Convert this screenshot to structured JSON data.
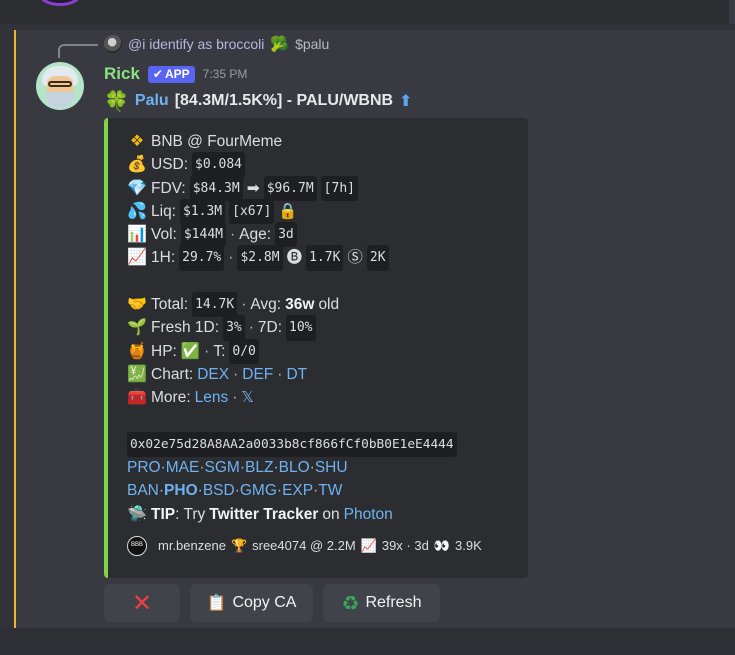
{
  "reply": {
    "mention": "@i identify as broccoli",
    "text": "$palu"
  },
  "message": {
    "username": "Rick",
    "badge": "APP",
    "time": "7:35 PM",
    "title_link": "Palu",
    "title_rest": "[84.3M/1.5K%] - PALU/WBNB"
  },
  "embed": {
    "chain": "BNB @ FourMeme",
    "usd_label": "USD:",
    "usd": "$0.084",
    "fdv_label": "FDV:",
    "fdv_from": "$84.3M",
    "fdv_to": "$96.7M",
    "fdv_age": "[7h]",
    "liq_label": "Liq:",
    "liq": "$1.3M",
    "liq_mult": "[x67]",
    "vol_label": "Vol:",
    "vol": "$144M",
    "age_label": "Age:",
    "age": "3d",
    "h1_label": "1H:",
    "h1_pct": "29.7%",
    "h1_vol": "$2.8M",
    "h1_b": "1.7K",
    "h1_s": "2K",
    "total_label": "Total:",
    "total": "14.7K",
    "avg_label": "Avg:",
    "avg": "36w",
    "avg_suffix": "old",
    "fresh_label": "Fresh 1D:",
    "fresh_1d": "3%",
    "fresh_7d_label": "7D:",
    "fresh_7d": "10%",
    "hp_label": "HP:",
    "t_label": "T:",
    "t_value": "0/0",
    "chart_label": "Chart:",
    "chart_links": [
      "DEX",
      "DEF",
      "DT"
    ],
    "more_label": "More:",
    "more_links": [
      "Lens",
      "𝕏"
    ],
    "contract": "0x02e75d28A8AA2a0033b8cf866fCf0bB0E1eE4444",
    "bots_row1": [
      "PRO",
      "MAE",
      "SGM",
      "BLZ",
      "BLO",
      "SHU"
    ],
    "bots_row2": [
      "BAN",
      "PHO",
      "BSD",
      "GMG",
      "EXP",
      "TW"
    ],
    "tip_label": "TIP",
    "tip_pre": ": Try",
    "tip_bold": "Twitter Tracker",
    "tip_mid": "on",
    "tip_link": "Photon",
    "footer_user": "mr.benzene",
    "footer_caller": "sree4074 @ 2.2M",
    "footer_stats": "39x · 3d",
    "footer_views": "3.9K"
  },
  "buttons": {
    "copy": "Copy CA",
    "refresh": "Refresh"
  }
}
